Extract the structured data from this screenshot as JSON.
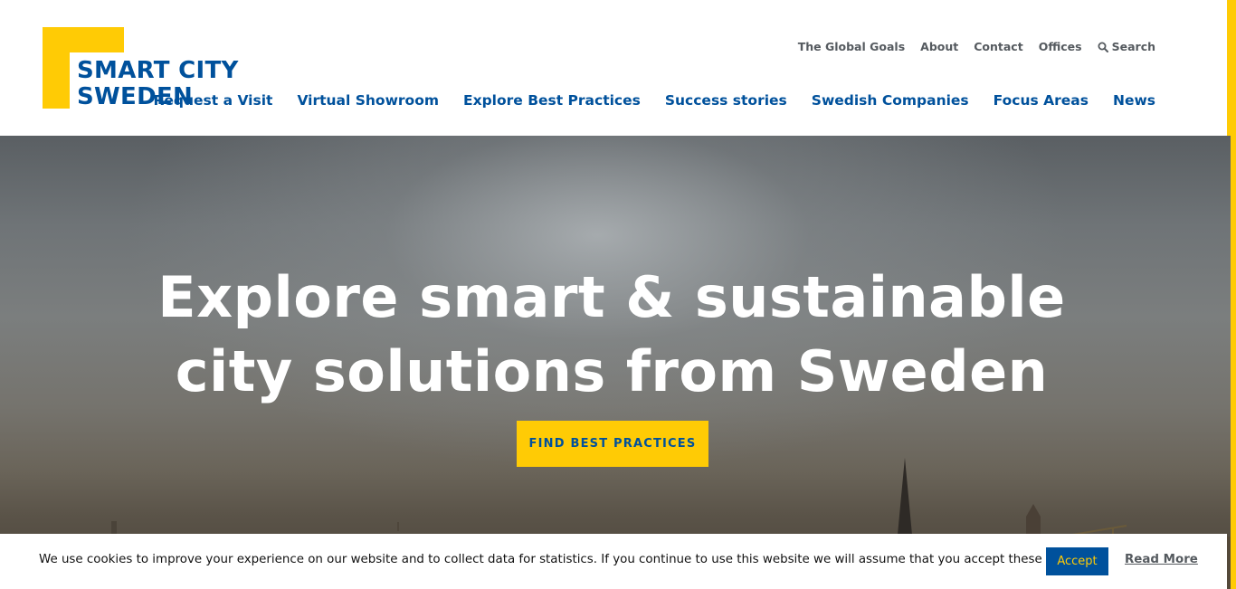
{
  "brand": {
    "logo_line1": "SMART CITY",
    "logo_line2": "SWEDEN",
    "primary_color": "#00519c",
    "accent_color": "#ffcb05"
  },
  "utility_nav": {
    "items": [
      {
        "label": "The Global Goals"
      },
      {
        "label": "About"
      },
      {
        "label": "Contact"
      },
      {
        "label": "Offices"
      }
    ],
    "search_label": "Search",
    "search_icon": "search-icon"
  },
  "main_nav": {
    "items": [
      {
        "label": "Request a Visit"
      },
      {
        "label": "Virtual Showroom"
      },
      {
        "label": "Explore Best Practices"
      },
      {
        "label": "Success stories"
      },
      {
        "label": "Swedish Companies"
      },
      {
        "label": "Focus Areas"
      },
      {
        "label": "News"
      }
    ]
  },
  "hero": {
    "title_line1": "Explore smart & sustainable",
    "title_line2": "city solutions from Sweden",
    "cta_label": "FIND BEST PRACTICES"
  },
  "cookie_bar": {
    "text": "We use cookies to improve your experience on our website and to collect data for statistics. If you continue to use this website we will assume that you accept these terms.",
    "accept_label": "Accept",
    "read_more_label": "Read More"
  }
}
